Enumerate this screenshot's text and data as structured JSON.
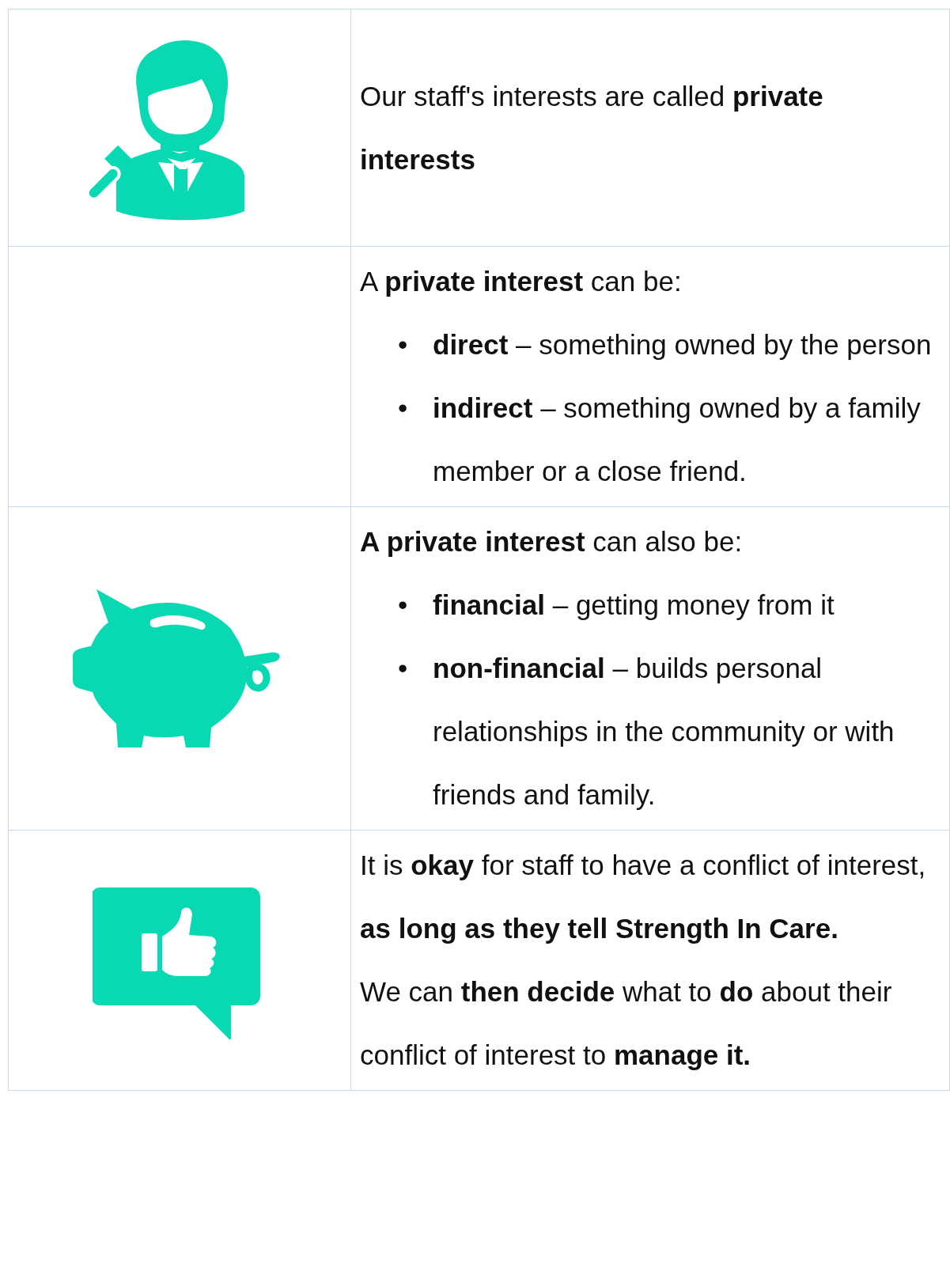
{
  "rows": [
    {
      "blocks": [
        {
          "kind": "paragraph",
          "text": "Our staff's interests are called **private interests**"
        }
      ]
    },
    {
      "blocks": [
        {
          "kind": "paragraph",
          "text": "A **private interest** can be:"
        },
        {
          "kind": "list",
          "items": [
            {
              "bullet": "•",
              "text": "**direct** – something owned by the person"
            },
            {
              "bullet": "•",
              "text": "**indirect** – something owned by a family member or a close friend."
            }
          ]
        }
      ]
    },
    {
      "blocks": [
        {
          "kind": "paragraph",
          "text": "**A private interest** can also be:"
        },
        {
          "kind": "list",
          "items": [
            {
              "bullet": "•",
              "text": "**financial** – getting money from it"
            },
            {
              "bullet": "•",
              "text": "**non-financial** – builds personal relationships in the community or with friends and family."
            }
          ]
        }
      ]
    },
    {
      "blocks": [
        {
          "kind": "paragraph",
          "text": "It is **okay** for staff to have a conflict of interest, **as long as they tell Strength In Care.**"
        },
        {
          "kind": "paragraph",
          "text": "We can **then decide** what to **do** about their conflict of interest to **manage it.**"
        }
      ]
    }
  ]
}
